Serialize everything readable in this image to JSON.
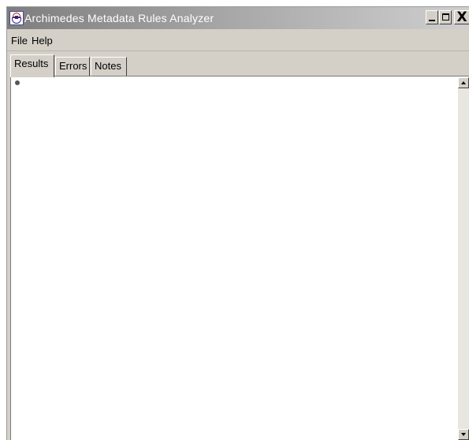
{
  "window": {
    "title": "Archimedes Metadata Rules Analyzer",
    "app_icon": "app-logo-icon",
    "controls": {
      "minimize_icon": "minimize-icon",
      "maximize_icon": "maximize-icon",
      "close_label": "X"
    }
  },
  "menubar": {
    "items": [
      {
        "label": "File"
      },
      {
        "label": "Help"
      }
    ]
  },
  "tabs": [
    {
      "label": "Results",
      "selected": true
    },
    {
      "label": "Errors",
      "selected": false
    },
    {
      "label": "Notes",
      "selected": false
    }
  ],
  "results_panel": {
    "bullet_icon": "bullet-icon",
    "content": ""
  },
  "colors": {
    "window_face": "#d4d0c8",
    "title_gradient_start": "#7e7e7e",
    "title_gradient_end": "#cfcfcf",
    "content_bg": "#ffffff"
  }
}
